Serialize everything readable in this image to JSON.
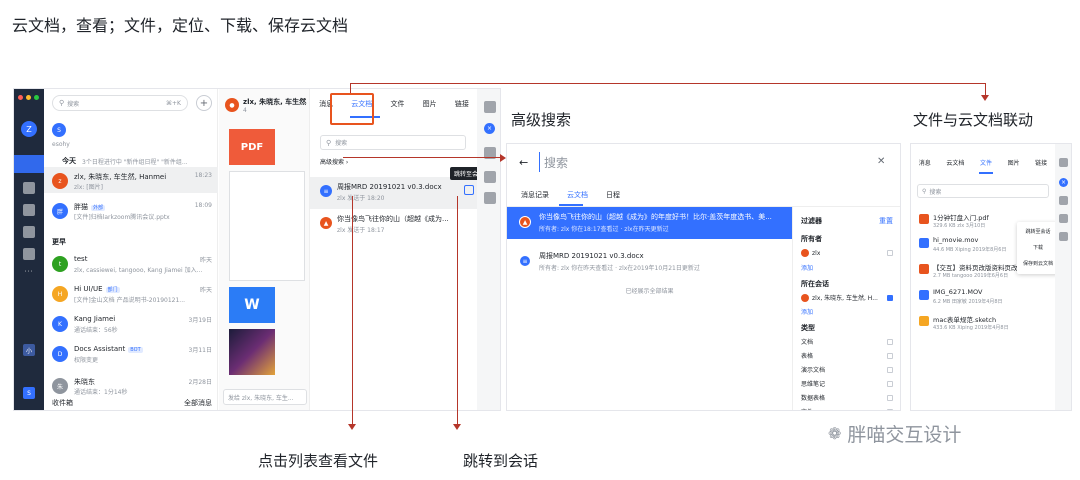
{
  "heading": "云文档，查看；文件，定位、下载、保存云文档",
  "annotations": {
    "advanced_search": "高级搜索",
    "linkage": "文件与云文档联动",
    "click_list": "点击列表查看文件",
    "jump_chat": "跳转到会话"
  },
  "watermark": "胖喵交互设计",
  "sidebar": {
    "avatar": "Z",
    "org1": "小",
    "org2": "S"
  },
  "chatlist": {
    "search_placeholder": "搜索",
    "search_hotkey": "⌘+K",
    "today_label": "今天",
    "today_desc": "3个日程进行中 \"新件组日程\" \"新件组...",
    "more_label": "更早",
    "top_user": "esohy",
    "items": [
      {
        "name": "zlx, 朱晓东, 车生然, Hanmei",
        "sub": "zlx: [图片]",
        "time": "18:23",
        "color": "#e8541e"
      },
      {
        "name": "胖猫",
        "tag": "外部",
        "sub": "[文件]归档larkzoom腾讯会议.pptx",
        "time": "18:09",
        "color": "#3370ff"
      },
      {
        "name": "test",
        "sub": "zlx, cassiewei, tangooo, Kang Jiamei 加入...",
        "time": "昨天",
        "color": "#2ea121"
      },
      {
        "name": "Hi UI/UE",
        "tag": "部门",
        "sub": "[文件]金山文档 产品说明书-20190121...",
        "time": "昨天",
        "color": "#f5a623"
      },
      {
        "name": "Kang Jiamei",
        "sub": "通话结束：56秒",
        "time": "3月19日",
        "color": "#3370ff"
      },
      {
        "name": "Docs Assistant",
        "tag": "BOT",
        "sub": "权限变更",
        "time": "3月11日",
        "color": "#3370ff"
      },
      {
        "name": "朱晓东",
        "sub": "通话结束：1分14秒",
        "time": "2月28日",
        "color": "#8f959e"
      }
    ],
    "footer_left": "收件箱",
    "footer_right": "全部消息"
  },
  "chat": {
    "title": "zlx, 朱晓东, 车生然...",
    "members": "4",
    "input_placeholder": "发给 zlx, 朱晓东, 车生..."
  },
  "panel": {
    "tabs": [
      "消息",
      "云文档",
      "文件",
      "图片",
      "链接"
    ],
    "search_placeholder": "搜索",
    "advanced": "高级搜索",
    "tooltip": "跳转至会话",
    "docs": [
      {
        "title": "周报MRD 20191021 v0.3.docx",
        "sub": "zlx 发送于 18:20"
      },
      {
        "title": "你当像鸟飞往你的山（超越《成为...",
        "sub": "zlx 发送于 18:17"
      }
    ]
  },
  "adv": {
    "placeholder": "搜索",
    "tabs": [
      "消息记录",
      "云文档",
      "日程"
    ],
    "results": [
      {
        "title": "你当像鸟飞往你的山（超越《成为》的年度好书！比尔·盖茨年度选书、美...",
        "sub": "所有者: zlx  你在18:17查看过 · zlx在昨天更新过"
      },
      {
        "title": "周报MRD 20191021 v0.3.docx",
        "sub": "所有者: zlx  你在昨天查看过 · zlx在2019年10月21日更新过"
      }
    ],
    "end": "已经展示全部结果",
    "filter_title": "过滤器",
    "filter_reset": "重置",
    "owner_label": "所有者",
    "owner_name": "zlx",
    "add": "添加",
    "chat_label": "所在会话",
    "chat_name": "zlx, 朱晓东, 车生然, H...",
    "type_label": "类型",
    "types": [
      "文档",
      "表格",
      "演示文档",
      "思维笔记",
      "数据表格",
      "文件"
    ]
  },
  "files": {
    "tabs": [
      "消息",
      "云文档",
      "文件",
      "图片",
      "链接"
    ],
    "search_placeholder": "搜索",
    "items": [
      {
        "name": "1分钟钉盘入门.pdf",
        "sub": "329.6 KB  zlx  3月10日",
        "color": "#e8541e"
      },
      {
        "name": "hi_movie.mov",
        "sub": "44.6 MB  Xiping  2019年8月6日",
        "color": "#3370ff"
      },
      {
        "name": "【交互】资料页改版资料页改版新",
        "sub": "2.7 MB  tangooo  2019年6月6日",
        "color": "#e8541e"
      },
      {
        "name": "IMG_6271.MOV",
        "sub": "6.2 MB  田家敏  2019年4月8日",
        "color": "#3370ff"
      },
      {
        "name": "mac表单规范.sketch",
        "sub": "433.6 KB  Xiping  2019年4月8日",
        "color": "#f5a623"
      }
    ],
    "menu": [
      "跳转至会话",
      "下载",
      "保存到云文档"
    ]
  },
  "colors": {
    "accent": "#3370ff",
    "red": "#e8541e"
  }
}
